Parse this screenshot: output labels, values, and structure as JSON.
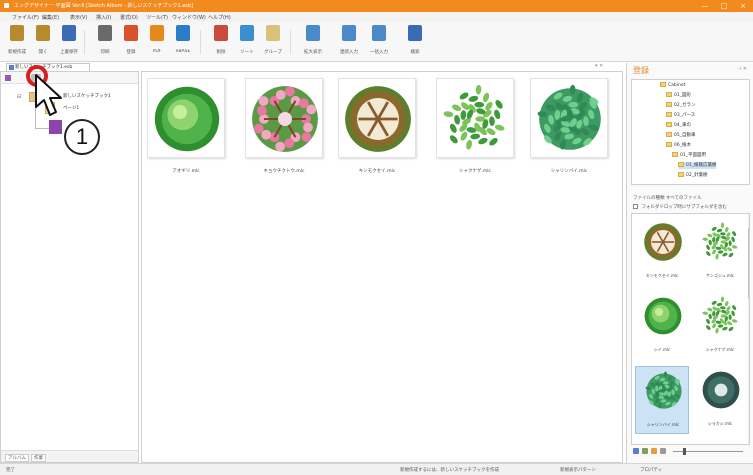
{
  "window": {
    "title": "エッグデザイナー 平面図 Ver.6 [Sketch Album - 新しいスケッチブック1.esb]",
    "controls": [
      "—",
      "□",
      "×"
    ]
  },
  "menu": [
    "ファイル(F)",
    "編集(E)",
    "表示(V)",
    "挿入(I)",
    "書式(O)",
    "ツール(T)",
    "ウィンドウ(W)",
    "ヘルプ(H)"
  ],
  "toolbar": [
    {
      "label": "新規作成",
      "icon": "new-file-icon",
      "color": "#b58b2e"
    },
    {
      "label": "開く",
      "icon": "open-icon",
      "color": "#b58b2e"
    },
    {
      "label": "上書保存",
      "icon": "save-icon",
      "color": "#3a6bb5"
    },
    {
      "label": "印刷",
      "icon": "print-icon",
      "color": "#6a6a6a"
    },
    {
      "label": "登録",
      "icon": "register-icon",
      "color": "#d9522e"
    },
    {
      "label": "PDF",
      "icon": "pdf-icon",
      "color": "#e6891b"
    },
    {
      "label": "eBASE",
      "icon": "ebase-icon",
      "color": "#2c7cc7"
    },
    {
      "label": "削除",
      "icon": "delete-icon",
      "color": "#c94b3b"
    },
    {
      "label": "ソート",
      "icon": "sort-icon",
      "color": "#3a8fd2"
    },
    {
      "label": "グループ",
      "icon": "group-icon",
      "color": "#d8c27b"
    },
    {
      "label": "拡大表示",
      "icon": "zoom-view-icon",
      "color": "#4a8ac9"
    },
    {
      "label": "連続入力",
      "icon": "continuous-input-icon",
      "color": "#4a8ac9"
    },
    {
      "label": "一括入力",
      "icon": "batch-input-icon",
      "color": "#4a8ac9"
    },
    {
      "label": "検索",
      "icon": "search-icon",
      "color": "#3a6bb5"
    }
  ],
  "doc_tab": "新しいスケッチブック1.esb",
  "left_panel": {
    "tree_root_label": "新しいスケッチブック1",
    "tree_sub_label": "ページ1",
    "bottom_tabs": [
      "アルバム",
      "作業"
    ]
  },
  "gallery": [
    {
      "name": "アオギリ.mlc",
      "kind": "round-green"
    },
    {
      "name": "キョウチクトウ.mlc",
      "kind": "pink-flower"
    },
    {
      "name": "キンモクセイ.mlc",
      "kind": "brown-ring"
    },
    {
      "name": "シャクナゲ.mlc",
      "kind": "leafy"
    },
    {
      "name": "シャリンバイ.mlc",
      "kind": "leafy-dense"
    }
  ],
  "right_panel": {
    "title": "登録",
    "tree": [
      {
        "label": "Cabinet",
        "level": 0,
        "selected": false
      },
      {
        "label": "01_図形",
        "level": 1,
        "selected": false
      },
      {
        "label": "02_ガラン",
        "level": 1,
        "selected": false
      },
      {
        "label": "03_パース",
        "level": 1,
        "selected": false
      },
      {
        "label": "04_車の",
        "level": 1,
        "selected": false
      },
      {
        "label": "05_自動車",
        "level": 1,
        "selected": false
      },
      {
        "label": "06_植木",
        "level": 1,
        "selected": false
      },
      {
        "label": "01_平面図用",
        "level": 2,
        "selected": false
      },
      {
        "label": "01_植栽広葉樹",
        "level": 3,
        "selected": true
      },
      {
        "label": "02_針葉樹",
        "level": 3,
        "selected": false
      }
    ],
    "file_type_label": "ファイルの種類",
    "file_type_value": "すべてのファイル",
    "checkbox_label": "フォルダドロップ時にサブフォルダを含む",
    "items": [
      {
        "name": "キンモクセイ.mlc",
        "kind": "brown-ring",
        "selected": false
      },
      {
        "name": "サンゴジュ.mlc",
        "kind": "leafy",
        "selected": false
      },
      {
        "name": "シイ.mlc",
        "kind": "round-green",
        "selected": false
      },
      {
        "name": "シャクナゲ.mlc",
        "kind": "leafy",
        "selected": false
      },
      {
        "name": "シャリンバイ.mlc",
        "kind": "leafy-dense",
        "selected": true
      },
      {
        "name": "シラカシ.mlc",
        "kind": "dark-round",
        "selected": false
      }
    ]
  },
  "statusbar": {
    "left": "完了",
    "mid": "新規作成するには、新しいスケッチブックを作成",
    "right1": "新規表示パターン",
    "right2": "プロパティ"
  },
  "annotation": {
    "callout_number": "1"
  }
}
